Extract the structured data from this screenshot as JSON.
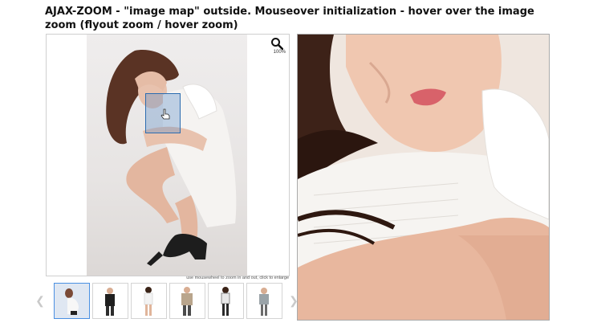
{
  "page": {
    "title": "AJAX-ZOOM - \"image map\" outside. Mouseover initialization - hover over the image zoom (flyout zoom / hover zoom)"
  },
  "viewer": {
    "zoom_level": "100%",
    "hint": "use mousewheel to zoom in and out, click to enlarge",
    "zoom_icon": "magnifier-zoom-icon"
  },
  "thumbnails": {
    "items": [
      {
        "name": "thumb-1",
        "active": true
      },
      {
        "name": "thumb-2",
        "active": false
      },
      {
        "name": "thumb-3",
        "active": false
      },
      {
        "name": "thumb-4",
        "active": false
      },
      {
        "name": "thumb-5",
        "active": false
      },
      {
        "name": "thumb-6",
        "active": false
      }
    ],
    "prev_icon": "chevron-left-icon",
    "next_icon": "chevron-right-icon"
  },
  "colors": {
    "accent": "#4a90e2",
    "lens": "#2b6cb0"
  }
}
